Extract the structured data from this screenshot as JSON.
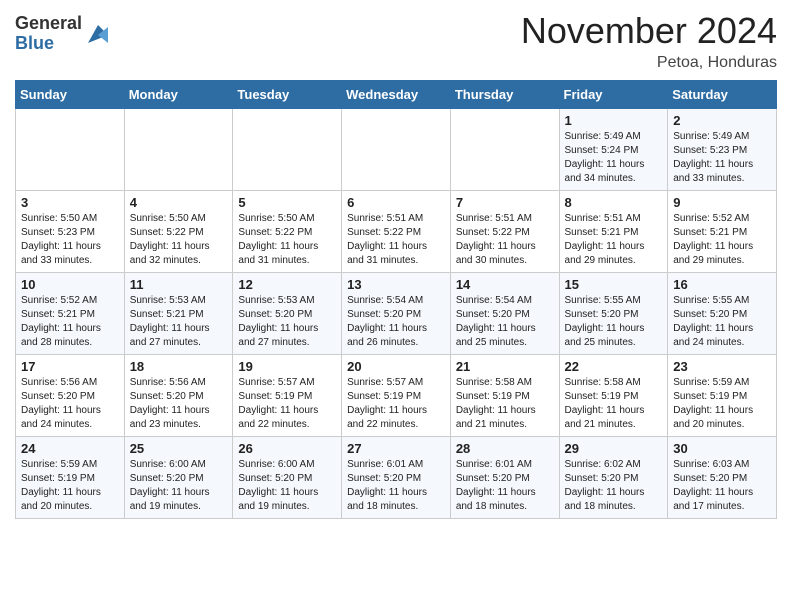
{
  "logo": {
    "general": "General",
    "blue": "Blue"
  },
  "header": {
    "month": "November 2024",
    "location": "Petoa, Honduras"
  },
  "days_of_week": [
    "Sunday",
    "Monday",
    "Tuesday",
    "Wednesday",
    "Thursday",
    "Friday",
    "Saturday"
  ],
  "weeks": [
    [
      {
        "day": "",
        "info": ""
      },
      {
        "day": "",
        "info": ""
      },
      {
        "day": "",
        "info": ""
      },
      {
        "day": "",
        "info": ""
      },
      {
        "day": "",
        "info": ""
      },
      {
        "day": "1",
        "info": "Sunrise: 5:49 AM\nSunset: 5:24 PM\nDaylight: 11 hours\nand 34 minutes."
      },
      {
        "day": "2",
        "info": "Sunrise: 5:49 AM\nSunset: 5:23 PM\nDaylight: 11 hours\nand 33 minutes."
      }
    ],
    [
      {
        "day": "3",
        "info": "Sunrise: 5:50 AM\nSunset: 5:23 PM\nDaylight: 11 hours\nand 33 minutes."
      },
      {
        "day": "4",
        "info": "Sunrise: 5:50 AM\nSunset: 5:22 PM\nDaylight: 11 hours\nand 32 minutes."
      },
      {
        "day": "5",
        "info": "Sunrise: 5:50 AM\nSunset: 5:22 PM\nDaylight: 11 hours\nand 31 minutes."
      },
      {
        "day": "6",
        "info": "Sunrise: 5:51 AM\nSunset: 5:22 PM\nDaylight: 11 hours\nand 31 minutes."
      },
      {
        "day": "7",
        "info": "Sunrise: 5:51 AM\nSunset: 5:22 PM\nDaylight: 11 hours\nand 30 minutes."
      },
      {
        "day": "8",
        "info": "Sunrise: 5:51 AM\nSunset: 5:21 PM\nDaylight: 11 hours\nand 29 minutes."
      },
      {
        "day": "9",
        "info": "Sunrise: 5:52 AM\nSunset: 5:21 PM\nDaylight: 11 hours\nand 29 minutes."
      }
    ],
    [
      {
        "day": "10",
        "info": "Sunrise: 5:52 AM\nSunset: 5:21 PM\nDaylight: 11 hours\nand 28 minutes."
      },
      {
        "day": "11",
        "info": "Sunrise: 5:53 AM\nSunset: 5:21 PM\nDaylight: 11 hours\nand 27 minutes."
      },
      {
        "day": "12",
        "info": "Sunrise: 5:53 AM\nSunset: 5:20 PM\nDaylight: 11 hours\nand 27 minutes."
      },
      {
        "day": "13",
        "info": "Sunrise: 5:54 AM\nSunset: 5:20 PM\nDaylight: 11 hours\nand 26 minutes."
      },
      {
        "day": "14",
        "info": "Sunrise: 5:54 AM\nSunset: 5:20 PM\nDaylight: 11 hours\nand 25 minutes."
      },
      {
        "day": "15",
        "info": "Sunrise: 5:55 AM\nSunset: 5:20 PM\nDaylight: 11 hours\nand 25 minutes."
      },
      {
        "day": "16",
        "info": "Sunrise: 5:55 AM\nSunset: 5:20 PM\nDaylight: 11 hours\nand 24 minutes."
      }
    ],
    [
      {
        "day": "17",
        "info": "Sunrise: 5:56 AM\nSunset: 5:20 PM\nDaylight: 11 hours\nand 24 minutes."
      },
      {
        "day": "18",
        "info": "Sunrise: 5:56 AM\nSunset: 5:20 PM\nDaylight: 11 hours\nand 23 minutes."
      },
      {
        "day": "19",
        "info": "Sunrise: 5:57 AM\nSunset: 5:19 PM\nDaylight: 11 hours\nand 22 minutes."
      },
      {
        "day": "20",
        "info": "Sunrise: 5:57 AM\nSunset: 5:19 PM\nDaylight: 11 hours\nand 22 minutes."
      },
      {
        "day": "21",
        "info": "Sunrise: 5:58 AM\nSunset: 5:19 PM\nDaylight: 11 hours\nand 21 minutes."
      },
      {
        "day": "22",
        "info": "Sunrise: 5:58 AM\nSunset: 5:19 PM\nDaylight: 11 hours\nand 21 minutes."
      },
      {
        "day": "23",
        "info": "Sunrise: 5:59 AM\nSunset: 5:19 PM\nDaylight: 11 hours\nand 20 minutes."
      }
    ],
    [
      {
        "day": "24",
        "info": "Sunrise: 5:59 AM\nSunset: 5:19 PM\nDaylight: 11 hours\nand 20 minutes."
      },
      {
        "day": "25",
        "info": "Sunrise: 6:00 AM\nSunset: 5:20 PM\nDaylight: 11 hours\nand 19 minutes."
      },
      {
        "day": "26",
        "info": "Sunrise: 6:00 AM\nSunset: 5:20 PM\nDaylight: 11 hours\nand 19 minutes."
      },
      {
        "day": "27",
        "info": "Sunrise: 6:01 AM\nSunset: 5:20 PM\nDaylight: 11 hours\nand 18 minutes."
      },
      {
        "day": "28",
        "info": "Sunrise: 6:01 AM\nSunset: 5:20 PM\nDaylight: 11 hours\nand 18 minutes."
      },
      {
        "day": "29",
        "info": "Sunrise: 6:02 AM\nSunset: 5:20 PM\nDaylight: 11 hours\nand 18 minutes."
      },
      {
        "day": "30",
        "info": "Sunrise: 6:03 AM\nSunset: 5:20 PM\nDaylight: 11 hours\nand 17 minutes."
      }
    ]
  ]
}
